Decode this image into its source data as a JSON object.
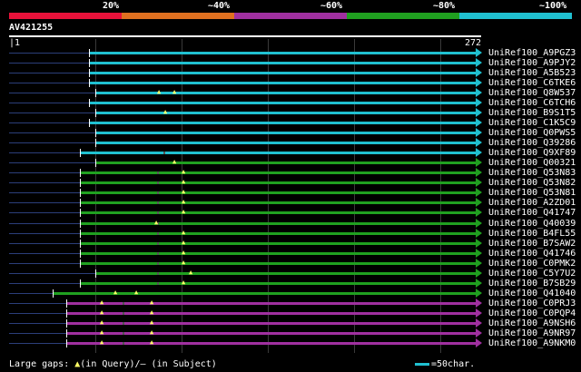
{
  "legend": {
    "labels": [
      "20%",
      "~40%",
      "~60%",
      "~80%",
      "~100%"
    ],
    "colors": [
      "#e8123a",
      "#e07020",
      "#a030a0",
      "#20a020",
      "#20c0d0"
    ]
  },
  "query": {
    "title": "AV421255",
    "start": "1",
    "end": "272"
  },
  "hits": [
    {
      "label": "UniRef100_A9PGZ3",
      "start": 35,
      "color": "#20c0d0",
      "gaps": []
    },
    {
      "label": "UniRef100_A9PJY2",
      "start": 35,
      "color": "#20c0d0",
      "gaps": []
    },
    {
      "label": "UniRef100_A5B523",
      "start": 35,
      "color": "#20c0d0",
      "gaps": []
    },
    {
      "label": "UniRef100_C6TKE6",
      "start": 35,
      "color": "#20c0d0",
      "gaps": []
    },
    {
      "label": "UniRef100_Q8W537",
      "start": 38,
      "color": "#20c0d0",
      "gaps": [],
      "qgaps": [
        65,
        72
      ]
    },
    {
      "label": "UniRef100_C6TCH6",
      "start": 35,
      "color": "#20c0d0",
      "gaps": []
    },
    {
      "label": "UniRef100_B9S1T5",
      "start": 38,
      "color": "#20c0d0",
      "gaps": [],
      "qgaps": [
        68
      ]
    },
    {
      "label": "UniRef100_C1K5C9",
      "start": 35,
      "color": "#20c0d0",
      "gaps": []
    },
    {
      "label": "UniRef100_Q0PWS5",
      "start": 38,
      "color": "#20c0d0",
      "gaps": []
    },
    {
      "label": "UniRef100_Q39286",
      "start": 38,
      "color": "#20c0d0",
      "gaps": []
    },
    {
      "label": "UniRef100_Q9XF89",
      "start": 31,
      "color": "#20c0d0",
      "gaps": [
        68
      ]
    },
    {
      "label": "UniRef100_Q00321",
      "start": 38,
      "color": "#20a020",
      "gaps": [],
      "qgaps": [
        72
      ]
    },
    {
      "label": "UniRef100_Q53N83",
      "start": 31,
      "color": "#20a020",
      "gaps": [
        65
      ],
      "qgaps": [
        76
      ]
    },
    {
      "label": "UniRef100_Q53N82",
      "start": 31,
      "color": "#20a020",
      "gaps": [
        65
      ],
      "qgaps": [
        76
      ]
    },
    {
      "label": "UniRef100_Q53N81",
      "start": 31,
      "color": "#20a020",
      "gaps": [
        65
      ],
      "qgaps": [
        76
      ]
    },
    {
      "label": "UniRef100_A2ZD01",
      "start": 31,
      "color": "#20a020",
      "gaps": [
        65
      ],
      "qgaps": [
        76
      ]
    },
    {
      "label": "UniRef100_Q41747",
      "start": 31,
      "color": "#20a020",
      "gaps": [
        65
      ],
      "qgaps": [
        76
      ]
    },
    {
      "label": "UniRef100_Q40039",
      "start": 31,
      "color": "#20a020",
      "gaps": [
        65
      ],
      "qgaps": [
        64
      ]
    },
    {
      "label": "UniRef100_B4FL55",
      "start": 31,
      "color": "#20a020",
      "gaps": [
        65
      ],
      "qgaps": [
        76
      ]
    },
    {
      "label": "UniRef100_B7SAW2",
      "start": 31,
      "color": "#20a020",
      "gaps": [
        65
      ],
      "qgaps": [
        76
      ]
    },
    {
      "label": "UniRef100_Q41746",
      "start": 31,
      "color": "#20a020",
      "gaps": [
        65
      ],
      "qgaps": [
        76
      ]
    },
    {
      "label": "UniRef100_C0PMK2",
      "start": 31,
      "color": "#20a020",
      "gaps": [
        65
      ],
      "qgaps": [
        76
      ]
    },
    {
      "label": "UniRef100_C5Y7U2",
      "start": 38,
      "color": "#20a020",
      "gaps": [
        65
      ],
      "qgaps": [
        79
      ]
    },
    {
      "label": "UniRef100_B7SB29",
      "start": 31,
      "color": "#20a020",
      "gaps": [
        65
      ],
      "qgaps": [
        76
      ]
    },
    {
      "label": "UniRef100_Q41040",
      "start": 19,
      "color": "#20a020",
      "gaps": [],
      "qgaps": [
        46,
        55
      ]
    },
    {
      "label": "UniRef100_C0PRJ3",
      "start": 25,
      "color": "#a030a0",
      "gaps": [
        50
      ],
      "qgaps": [
        40,
        62
      ]
    },
    {
      "label": "UniRef100_C0PQP4",
      "start": 25,
      "color": "#a030a0",
      "gaps": [
        50
      ],
      "qgaps": [
        40,
        62
      ]
    },
    {
      "label": "UniRef100_A9NSH6",
      "start": 25,
      "color": "#a030a0",
      "gaps": [
        50
      ],
      "qgaps": [
        40,
        62
      ]
    },
    {
      "label": "UniRef100_A9NR97",
      "start": 25,
      "color": "#a030a0",
      "gaps": [
        50
      ],
      "qgaps": [
        40,
        62
      ]
    },
    {
      "label": "UniRef100_A9NKM0",
      "start": 25,
      "color": "#a030a0",
      "gaps": [
        50
      ],
      "qgaps": [
        40,
        62
      ]
    }
  ],
  "footer": {
    "prefix": "Large gaps: ",
    "triangle": "▲",
    "suffix": "(in Query)/– (in Subject)",
    "scale_label": "=50char."
  }
}
